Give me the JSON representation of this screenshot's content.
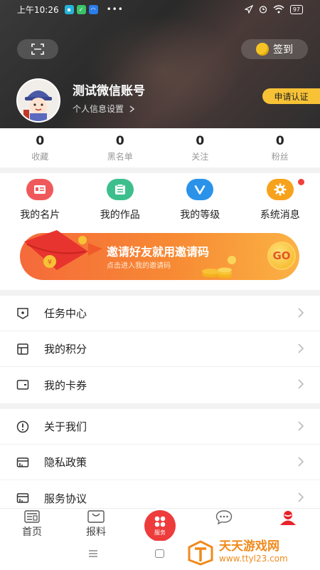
{
  "status_bar": {
    "time": "上午10:26",
    "dots": "•••",
    "battery": "97"
  },
  "header": {
    "checkin_label": "签到",
    "username": "测试微信账号",
    "settings_label": "个人信息设置",
    "apply_label": "申请认证"
  },
  "stats": [
    {
      "value": "0",
      "label": "收藏"
    },
    {
      "value": "0",
      "label": "黑名单"
    },
    {
      "value": "0",
      "label": "关注"
    },
    {
      "value": "0",
      "label": "粉丝"
    }
  ],
  "quick_actions": [
    {
      "label": "我的名片",
      "icon": "business-card-icon",
      "color": "#f0595b"
    },
    {
      "label": "我的作品",
      "icon": "works-icon",
      "color": "#3cbf8d"
    },
    {
      "label": "我的等级",
      "icon": "level-icon",
      "color": "#2b92ea"
    },
    {
      "label": "系统消息",
      "icon": "gear-icon",
      "color": "#f7a21c"
    }
  ],
  "banner": {
    "title": "邀请好友就用邀请码",
    "subtitle": "点击进入我的邀请码",
    "go_label": "GO"
  },
  "menu_group_1": [
    {
      "label": "任务中心",
      "icon": "task-icon"
    },
    {
      "label": "我的积分",
      "icon": "points-icon"
    },
    {
      "label": "我的卡券",
      "icon": "coupon-icon"
    }
  ],
  "menu_group_2": [
    {
      "label": "关于我们",
      "icon": "info-icon"
    },
    {
      "label": "隐私政策",
      "icon": "privacy-icon"
    },
    {
      "label": "服务协议",
      "icon": "agreement-icon"
    }
  ],
  "tabbar": {
    "tabs": [
      {
        "label": "首页",
        "icon": "home-icon"
      },
      {
        "label": "报料",
        "icon": "report-icon"
      },
      {
        "label": "",
        "icon": ""
      },
      {
        "label": "",
        "icon": "chat-icon"
      },
      {
        "label": "",
        "icon": "profile-icon",
        "active_color": "#e8232a"
      }
    ],
    "center_label": "服务"
  },
  "watermark": {
    "title": "天天游戏网",
    "url": "www.ttyl23.com"
  }
}
